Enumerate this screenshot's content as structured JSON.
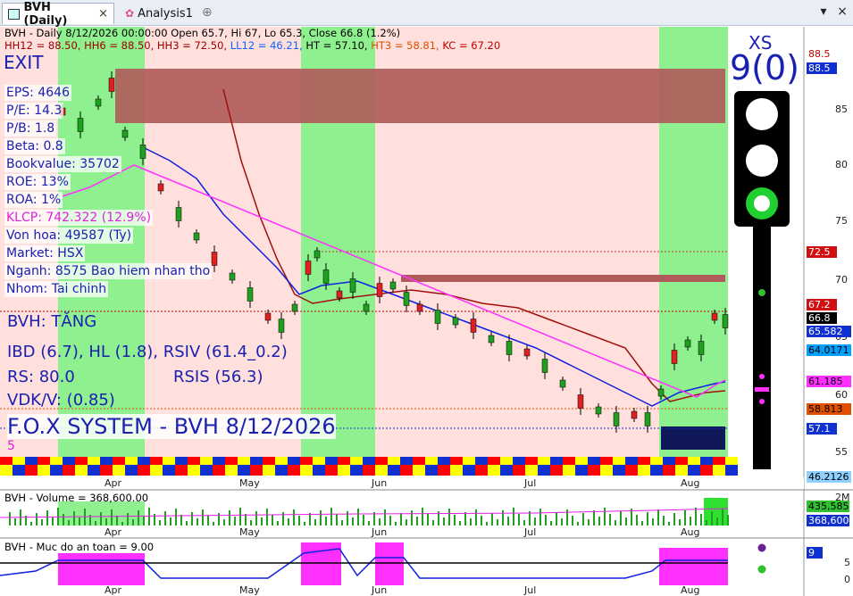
{
  "tabs": [
    {
      "label": "BVH (Daily)",
      "active": true
    },
    {
      "label": "Analysis1",
      "active": false
    }
  ],
  "header": {
    "line1": "BVH - Daily 8/12/2026 00:00:00 Open 65.7, Hi 67, Lo 65.3, Close 66.8 (1.2%)",
    "hh12": "HH12 = 88.50,",
    "hh6": "HH6 = 88.50,",
    "hh3": "HH3 = 72.50,",
    "ll12": "LL12 = 46.21,",
    "ht": "HT = 57.10,",
    "ht3": "HT3 = 58.81,",
    "kc": "KC = 67.20"
  },
  "signal": {
    "exit": "EXIT",
    "xs": "XS",
    "count": "9(0)"
  },
  "fundamentals": {
    "eps": "EPS: 4646",
    "pe": "P/E: 14.3",
    "pb": "P/B: 1.8",
    "beta": "Beta: 0.8",
    "bookvalue": "Bookvalue: 35702",
    "roe": "ROE: 13%",
    "roa": "ROA: 1%",
    "klcp": "KLCP: 742.322 (12.9%)",
    "vonhoa": "Von hoa: 49587 (Ty)",
    "market": "Market: HSX",
    "nganh": "Nganh: 8575 Bao hiem nhan tho",
    "nhom": "Nhom: Tai chinh"
  },
  "analysis": {
    "trend": "BVH: TĂNG",
    "ibd": "IBD (6.7), HL (1.8), RSIV (61.4_0.2)",
    "rs": "RS: 80.0",
    "rsis": "RSIS (56.3)",
    "vdk": "VDK/V:  (0.85)",
    "fox": "F.O.X SYSTEM - BVH 8/12/2026",
    "five": "5"
  },
  "price_axis": {
    "ticks": [
      "85",
      "80",
      "75",
      "70",
      "65",
      "60",
      "55"
    ],
    "tags": [
      {
        "label": "88.5",
        "bg": "#ffffff",
        "fg": "#c00000"
      },
      {
        "label": "88.5",
        "bg": "#1030d0",
        "fg": "#ffffff"
      },
      {
        "label": "72.5",
        "bg": "#d01010",
        "fg": "#ffffff"
      },
      {
        "label": "67.2",
        "bg": "#d01010",
        "fg": "#ffffff"
      },
      {
        "label": "66.8",
        "bg": "#000000",
        "fg": "#ffffff"
      },
      {
        "label": "65.582",
        "bg": "#1030d0",
        "fg": "#ffffff"
      },
      {
        "label": "64.0171",
        "bg": "#00a0ff",
        "fg": "#000000"
      },
      {
        "label": "61.185",
        "bg": "#ff30ff",
        "fg": "#000000"
      },
      {
        "label": "58.813",
        "bg": "#e05000",
        "fg": "#000000"
      },
      {
        "label": "57.1",
        "bg": "#1030d0",
        "fg": "#ffffff"
      },
      {
        "label": "46.2126",
        "bg": "#8fd0ff",
        "fg": "#000000"
      }
    ]
  },
  "months": [
    "Apr",
    "May",
    "Jun",
    "Jul",
    "Aug"
  ],
  "volume": {
    "title": "BVH - Volume = 368,600.00",
    "ticks": [
      "2M"
    ],
    "tags": [
      {
        "label": "435,585",
        "bg": "#30c030",
        "fg": "#000"
      },
      {
        "label": "368,600",
        "bg": "#1030d0",
        "fg": "#fff"
      }
    ]
  },
  "safety": {
    "title": "BVH - Muc do an toan = 9.00",
    "ticks": [
      "9",
      "5",
      "0"
    ]
  },
  "bottom_axis": [
    "Apr",
    "May",
    "Jun",
    "Jul",
    "Aug"
  ],
  "colors": {
    "green": "#8ef08e",
    "pink": "#ffe0dc",
    "blue": "#1a20b0"
  }
}
